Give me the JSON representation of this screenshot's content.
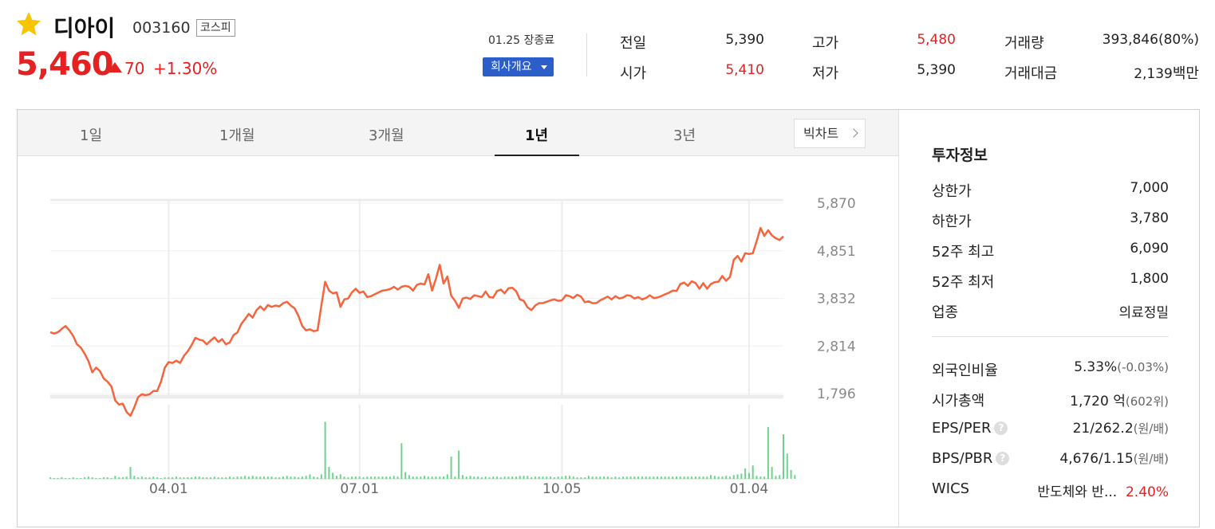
{
  "stock": {
    "name": "디아이",
    "code": "003160",
    "market": "코스피",
    "price": "5,460",
    "change": "70",
    "change_rate": "+1.30%",
    "session": "01.25 장종료",
    "company_button": "회사개요"
  },
  "quote": {
    "prev_label": "전일",
    "prev_value": "5,390",
    "open_label": "시가",
    "open_value": "5,410",
    "high_label": "고가",
    "high_value": "5,480",
    "low_label": "저가",
    "low_value": "5,390",
    "volume_label": "거래량",
    "volume_value": "393,846(80%)",
    "amount_label": "거래대금",
    "amount_value": "2,139",
    "amount_unit": "백만"
  },
  "tabs": [
    "1일",
    "1개월",
    "3개월",
    "1년",
    "3년"
  ],
  "active_tab": "1년",
  "big_chart_button": "빅차트",
  "colors": {
    "up": "#e52121",
    "down": "#2b5ec9",
    "line": "#f5643c",
    "volume": "#6fd28b"
  },
  "info": {
    "title": "투자정보",
    "upper_limit_label": "상한가",
    "upper_limit_value": "7,000",
    "lower_limit_label": "하한가",
    "lower_limit_value": "3,780",
    "high52_label": "52주 최고",
    "high52_value": "6,090",
    "low52_label": "52주 최저",
    "low52_value": "1,800",
    "industry_label": "업종",
    "industry_value": "의료정밀",
    "foreign_label": "외국인비율",
    "foreign_value": "5.33%",
    "foreign_change": "(-0.03%)",
    "mcap_label": "시가총액",
    "mcap_value": "1,720",
    "mcap_unit": "억",
    "mcap_rank": "(602위)",
    "eps_label": "EPS/PER",
    "eps_value": "21/262.2",
    "eps_unit": "(원/배)",
    "bps_label": "BPS/PBR",
    "bps_value": "4,676/1.15",
    "bps_unit": "(원/배)",
    "wics_label": "WICS",
    "wics_value": "반도체와 반...",
    "wics_rate": "2.40%",
    "help_icon": "?"
  },
  "chart_data": {
    "type": "line",
    "y_ticks": [
      "5,870",
      "4,851",
      "3,832",
      "2,814",
      "1,796"
    ],
    "ylim": [
      1796,
      5870
    ],
    "x_ticks": [
      "04.01",
      "07.01",
      "10.05",
      "01.04"
    ],
    "x_tick_index": [
      31,
      81,
      134,
      183
    ],
    "price_series": [
      3110,
      3080,
      3110,
      3180,
      3240,
      3150,
      3030,
      2850,
      2780,
      2650,
      2490,
      2250,
      2350,
      2280,
      2120,
      2050,
      1950,
      1650,
      1560,
      1580,
      1400,
      1320,
      1500,
      1720,
      1780,
      1760,
      1780,
      1850,
      1850,
      2050,
      2350,
      2470,
      2450,
      2500,
      2450,
      2600,
      2700,
      2830,
      2990,
      2950,
      2930,
      2850,
      2930,
      3000,
      2900,
      2960,
      2850,
      2890,
      3050,
      3100,
      3280,
      3390,
      3500,
      3420,
      3580,
      3660,
      3580,
      3690,
      3650,
      3680,
      3660,
      3730,
      3760,
      3680,
      3620,
      3460,
      3240,
      3150,
      3170,
      3130,
      3150,
      3680,
      4190,
      4000,
      3940,
      3960,
      3650,
      3810,
      3830,
      3960,
      4040,
      3950,
      3980,
      3860,
      3880,
      3920,
      3960,
      4000,
      4010,
      4030,
      4080,
      4020,
      4080,
      4100,
      4080,
      4000,
      4120,
      4150,
      4130,
      4350,
      4000,
      4250,
      4550,
      4150,
      4300,
      3890,
      3780,
      3630,
      3830,
      3850,
      3820,
      3900,
      3880,
      3860,
      3980,
      3860,
      3850,
      3990,
      4020,
      3940,
      4050,
      4060,
      3990,
      3810,
      3780,
      3640,
      3580,
      3680,
      3730,
      3730,
      3760,
      3790,
      3810,
      3780,
      3790,
      3900,
      3880,
      3840,
      3910,
      3870,
      3750,
      3770,
      3730,
      3730,
      3790,
      3830,
      3870,
      3810,
      3880,
      3830,
      3850,
      3900,
      3890,
      3830,
      3860,
      3810,
      3840,
      3900,
      3840,
      3850,
      3880,
      3920,
      3950,
      4000,
      3990,
      4140,
      4170,
      4100,
      4200,
      4160,
      4040,
      4160,
      4040,
      4140,
      4180,
      4190,
      4310,
      4210,
      4290,
      4660,
      4740,
      4620,
      4800,
      4780,
      4800,
      5060,
      5340,
      5170,
      5290,
      5180,
      5120,
      5080,
      5160
    ],
    "volume_series": [
      2,
      1,
      1,
      2,
      1,
      1,
      2,
      1,
      1,
      2,
      3,
      2,
      1,
      1,
      2,
      2,
      1,
      4,
      2,
      2,
      3,
      16,
      4,
      2,
      3,
      2,
      2,
      3,
      2,
      1,
      2,
      2,
      2,
      3,
      2,
      2,
      2,
      2,
      3,
      3,
      2,
      2,
      2,
      3,
      2,
      2,
      2,
      3,
      2,
      3,
      3,
      4,
      3,
      4,
      3,
      3,
      3,
      3,
      3,
      2,
      2,
      3,
      4,
      3,
      3,
      2,
      3,
      4,
      6,
      3,
      2,
      6,
      77,
      16,
      8,
      4,
      6,
      3,
      2,
      3,
      3,
      3,
      2,
      3,
      3,
      3,
      3,
      3,
      3,
      3,
      4,
      3,
      48,
      9,
      5,
      3,
      3,
      3,
      4,
      3,
      3,
      3,
      3,
      3,
      6,
      30,
      3,
      38,
      5,
      3,
      4,
      3,
      3,
      2,
      3,
      2,
      3,
      3,
      2,
      3,
      3,
      3,
      3,
      4,
      4,
      4,
      2,
      3,
      3,
      3,
      3,
      3,
      2,
      3,
      3,
      4,
      4,
      3,
      2,
      2,
      2,
      4,
      3,
      3,
      3,
      3,
      3,
      2,
      3,
      2,
      3,
      3,
      3,
      3,
      3,
      3,
      3,
      3,
      3,
      3,
      3,
      3,
      3,
      3,
      3,
      3,
      3,
      3,
      3,
      3,
      3,
      3,
      3,
      5,
      4,
      3,
      3,
      4,
      3,
      5,
      6,
      7,
      14,
      8,
      18,
      4,
      3,
      3,
      70,
      16,
      4,
      5,
      60,
      34,
      12,
      5
    ],
    "volume_max": 100
  }
}
